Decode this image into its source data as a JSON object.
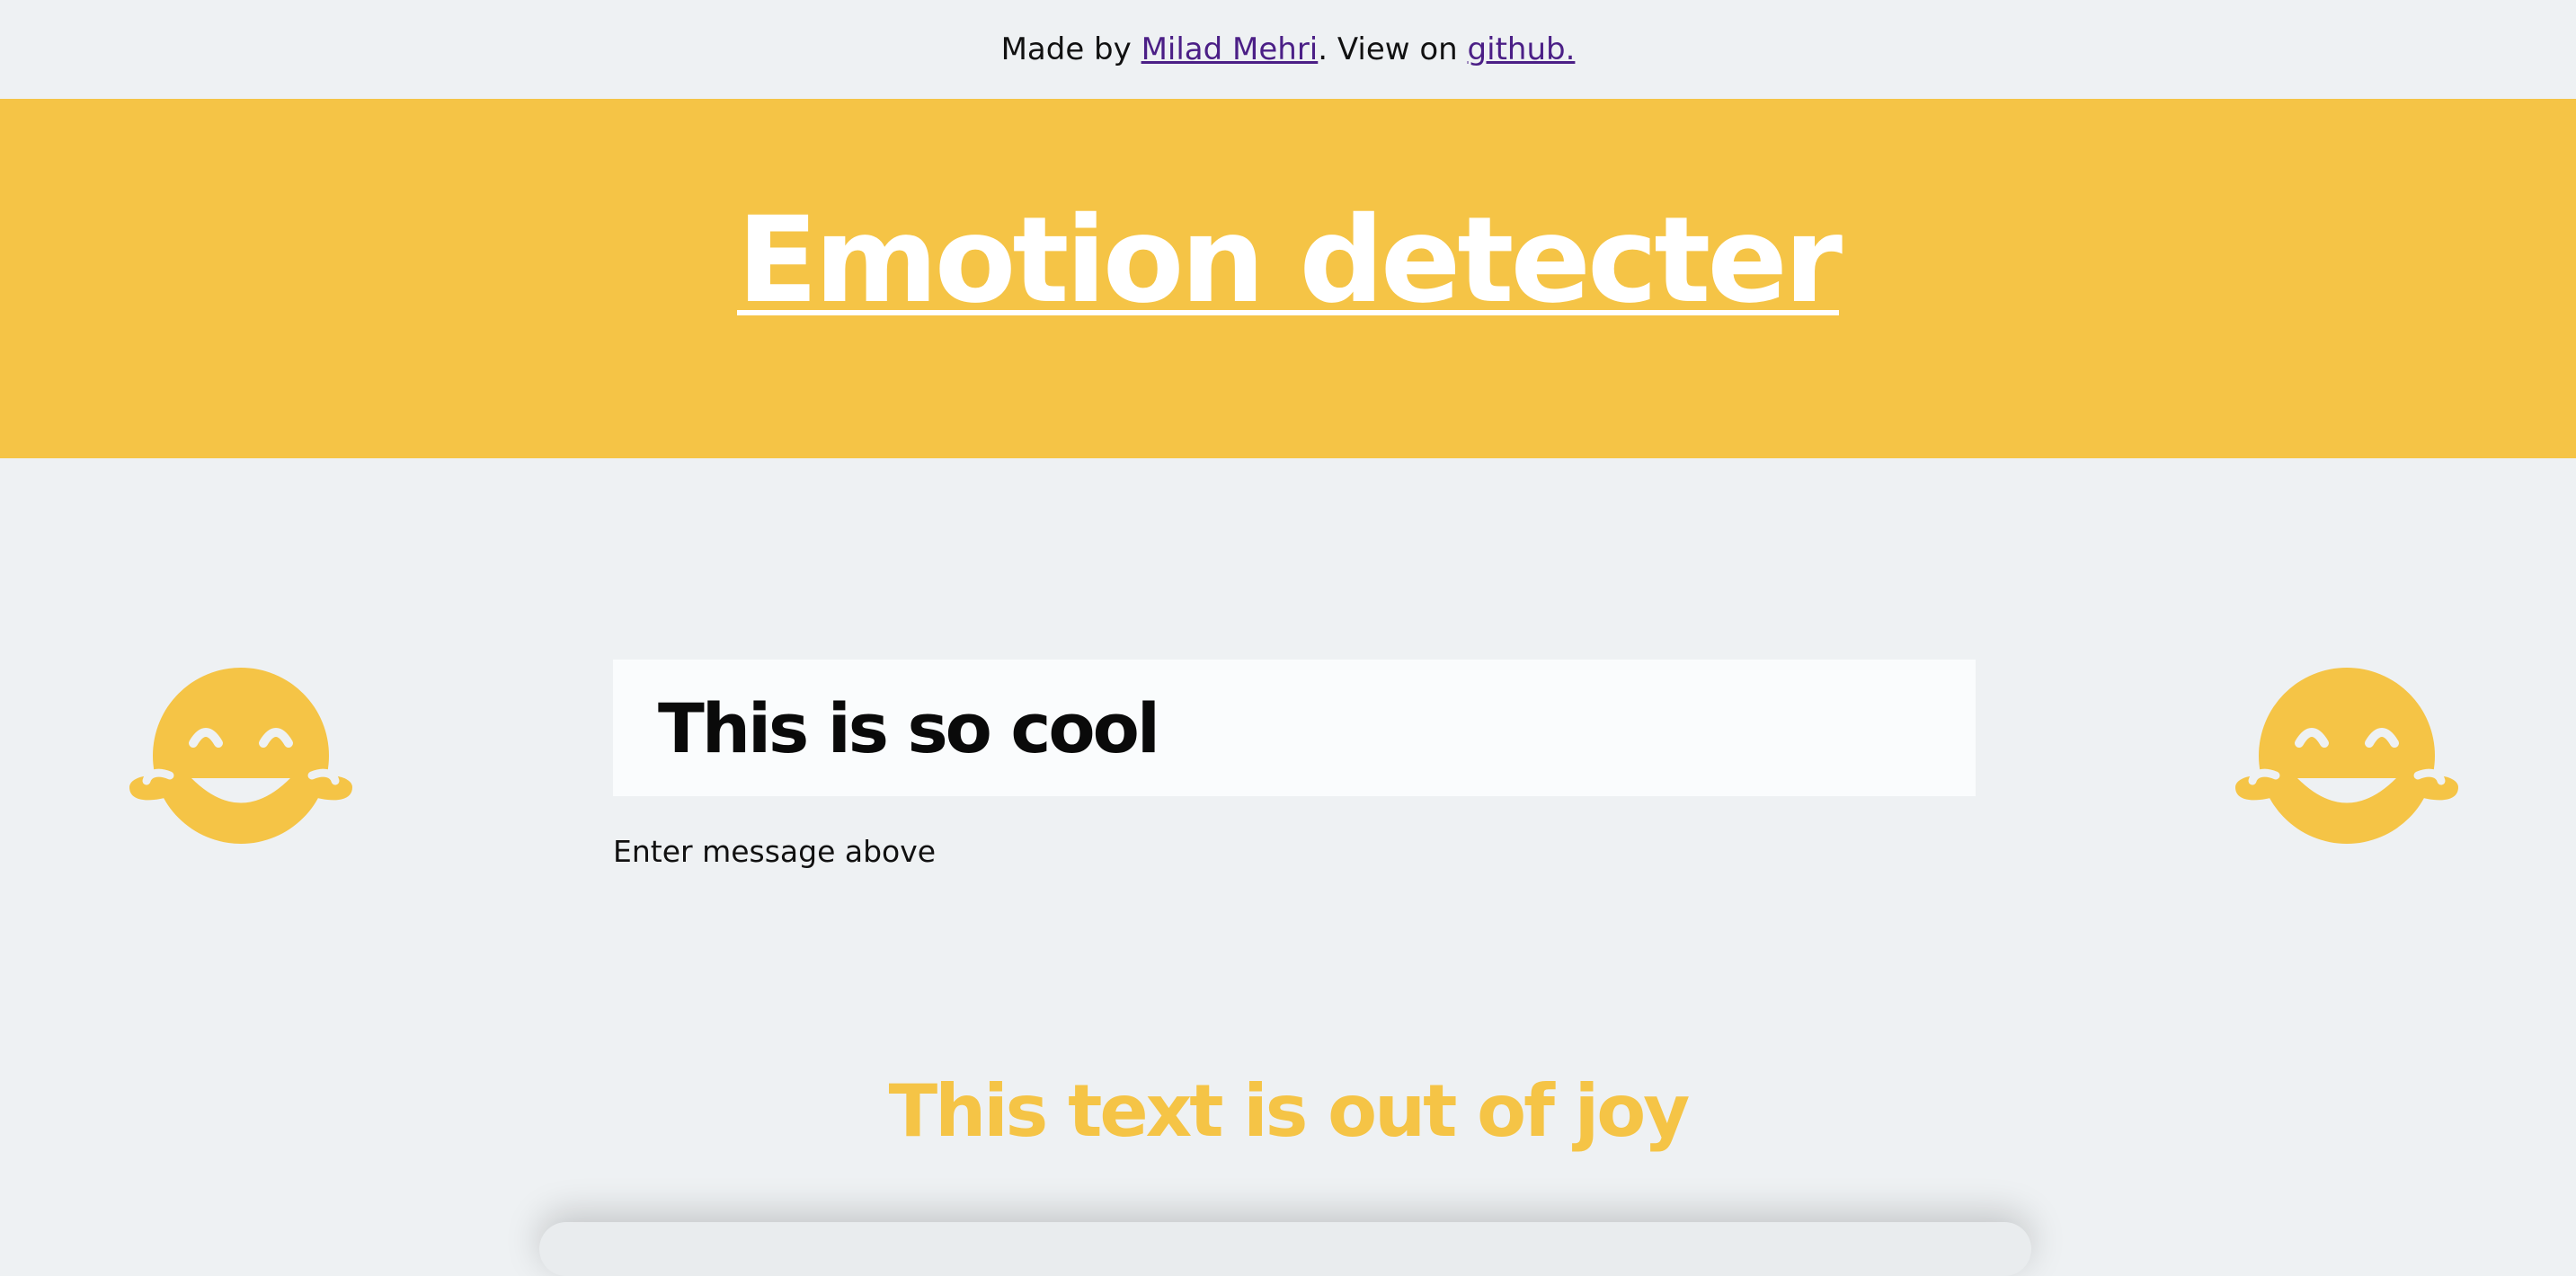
{
  "credits": {
    "prefix": "Made by ",
    "author_link": "Milad Mehri",
    "middle": ". View on ",
    "repo_link": "github."
  },
  "header": {
    "title": "Emotion detecter"
  },
  "message_input": {
    "value": "This is so cool",
    "helper": "Enter message above"
  },
  "result": {
    "text": "This text is out of joy"
  },
  "emotion": {
    "icon": "face-with-tears-of-joy-icon",
    "color": "#f5c446"
  },
  "colors": {
    "accent": "#f5c446",
    "background": "#eef1f3",
    "link": "#4b1f86"
  }
}
